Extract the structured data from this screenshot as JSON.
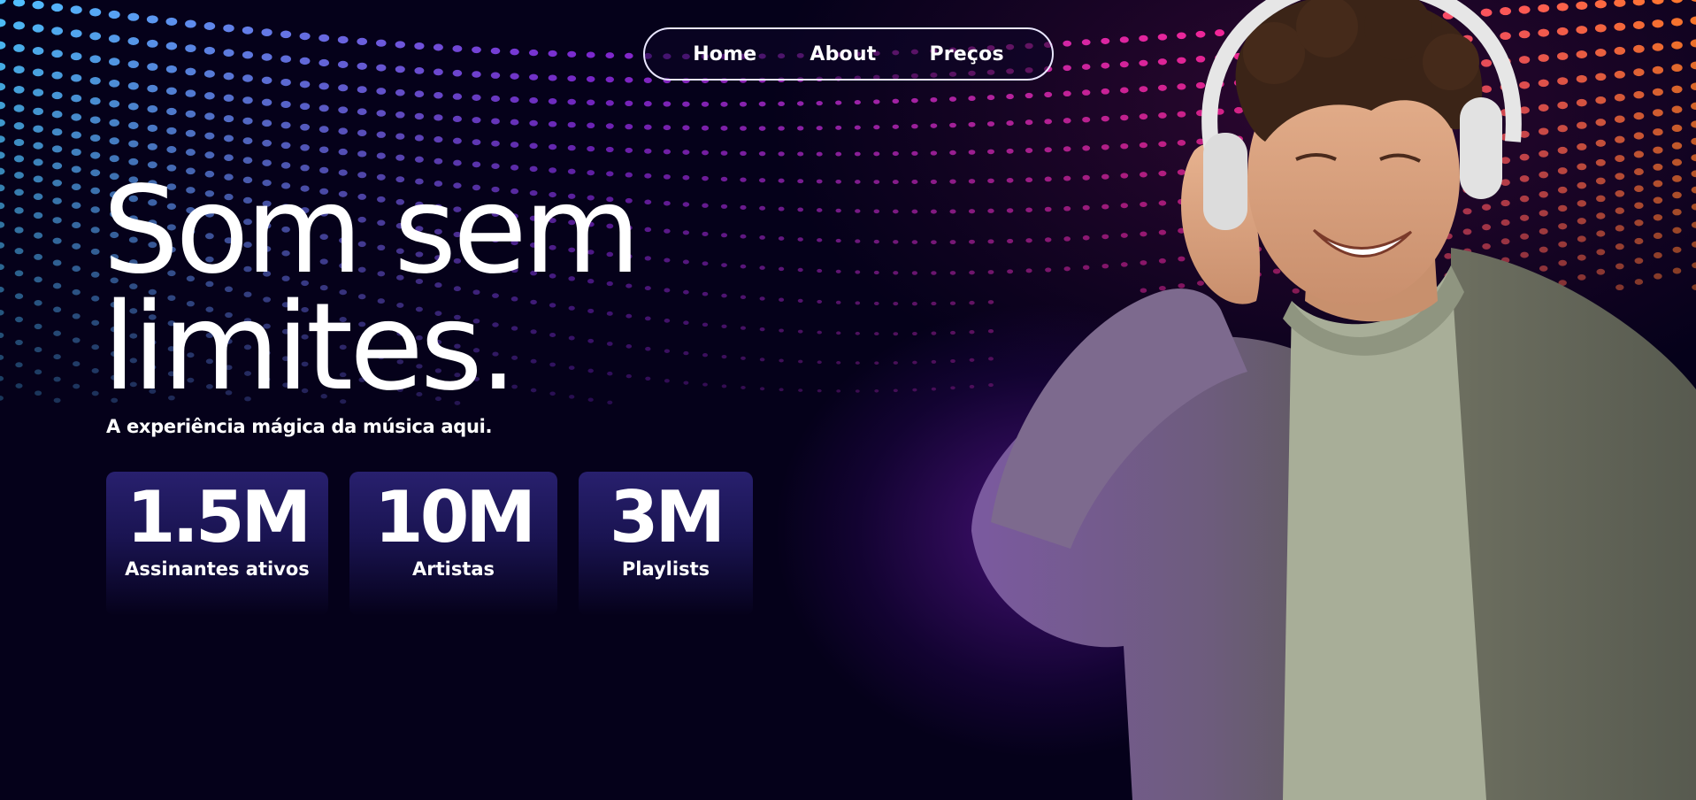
{
  "nav": {
    "items": [
      {
        "label": "Home"
      },
      {
        "label": "About"
      },
      {
        "label": "Preços"
      }
    ]
  },
  "hero": {
    "title_line1": "Som sem",
    "title_line2": "limites.",
    "subtitle": "A experiência mágica da música aqui."
  },
  "stats": [
    {
      "value": "1.5M",
      "label": "Assinantes ativos"
    },
    {
      "value": "10M",
      "label": "Artistas"
    },
    {
      "value": "3M",
      "label": "Playlists"
    }
  ],
  "colors": {
    "background": "#05011a",
    "stat_card": "#231b66",
    "dots_left": "#4fc3ff",
    "dots_mid": "#8a2be2",
    "dots_right": "#ff7a2a",
    "glow": "#6b1fb5"
  },
  "image": {
    "subject": "smiling young man with curly hair wearing white headphones, green t-shirt and grey jacket"
  }
}
